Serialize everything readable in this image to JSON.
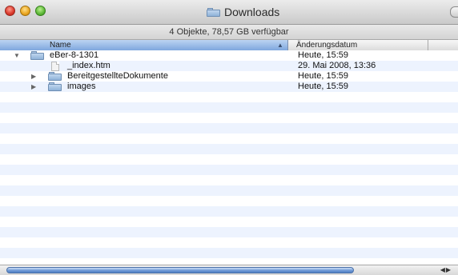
{
  "window": {
    "title": "Downloads",
    "status": "4 Objekte, 78,57 GB verfügbar"
  },
  "columns": {
    "name": "Name",
    "date": "Änderungsdatum"
  },
  "rows": [
    {
      "name": "eBer-8-1301",
      "date": "Heute, 15:59",
      "kind": "folder",
      "disclosure": "expanded",
      "level": 0
    },
    {
      "name": "_index.htm",
      "date": "29. Mai 2008, 13:36",
      "kind": "file",
      "disclosure": "none",
      "level": 1
    },
    {
      "name": "BereitgestellteDokumente",
      "date": "Heute, 15:59",
      "kind": "folder",
      "disclosure": "collapsed",
      "level": 1
    },
    {
      "name": "images",
      "date": "Heute, 15:59",
      "kind": "folder",
      "disclosure": "collapsed",
      "level": 1
    }
  ],
  "colors": {
    "stripe": "#edf3fe",
    "header_selected": "#7fa7de"
  }
}
